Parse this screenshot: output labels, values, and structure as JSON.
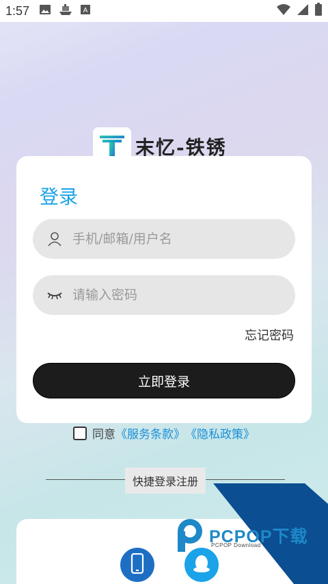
{
  "status_bar": {
    "time": "1:57",
    "left_icons": [
      "image-icon",
      "ship-icon",
      "a-box-icon"
    ],
    "right_icons": [
      "wifi-icon",
      "signal-icon",
      "battery-icon"
    ]
  },
  "brand": {
    "name": "末忆-铁锈",
    "logo_icon": "t-logo-icon",
    "accent_color": "#1aa3e8"
  },
  "login_card": {
    "title": "登录",
    "username_placeholder": "手机/邮箱/用户名",
    "username_value": "",
    "password_placeholder": "请输入密码",
    "password_value": "",
    "forgot_password": "忘记密码",
    "submit_label": "立即登录"
  },
  "agreement": {
    "prefix": "同意",
    "terms_link": "《服务条款》",
    "privacy_link": "《隐私政策》",
    "checked": false
  },
  "quick_login": {
    "label": "快捷登录注册",
    "options": [
      {
        "icon": "phone-icon",
        "color": "#1e6fc4"
      },
      {
        "icon": "qq-icon",
        "color": "#1aa3e8"
      }
    ]
  },
  "watermark": {
    "brand": "PCPOP下载",
    "sub": "PCPOP Download"
  }
}
